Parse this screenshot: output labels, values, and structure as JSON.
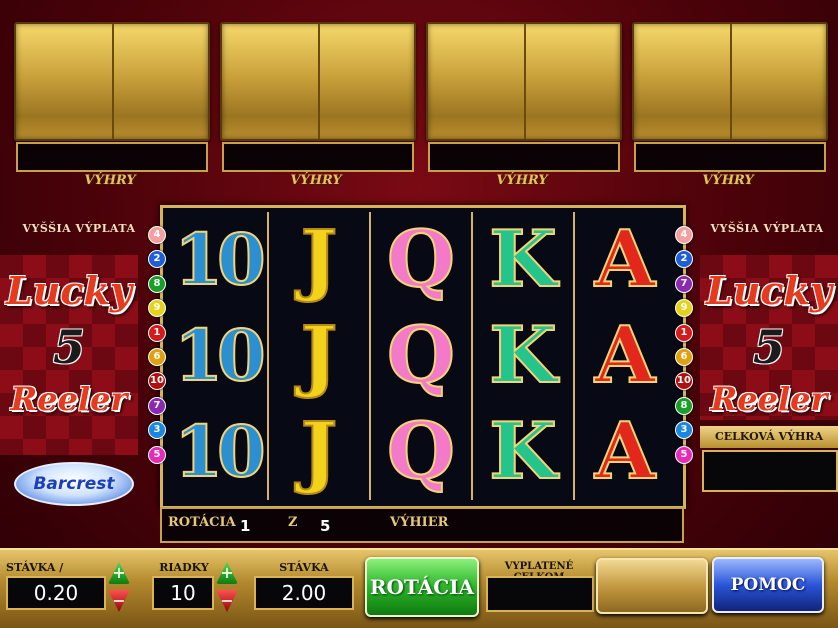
{
  "top_panels": {
    "win_label": "VÝHRY",
    "panels": [
      {
        "label": "VÝHRY"
      },
      {
        "label": "VÝHRY"
      },
      {
        "label": "VÝHRY"
      },
      {
        "label": "VÝHRY"
      }
    ]
  },
  "left_panel": {
    "vyssia": "VYŠŠIA VÝPLATA",
    "lucky": "Lucky",
    "five": "5",
    "reeler": "Reeler",
    "logo": "Barcrest"
  },
  "right_panel": {
    "vyssia": "VYŠŠIA VÝPLATA",
    "lucky": "Lucky",
    "five": "5",
    "reeler": "Reeler",
    "total_win_label": "CELKOVÁ VÝHRA"
  },
  "reels": [
    {
      "symbol": "10",
      "rows": [
        "10",
        "10",
        "10"
      ]
    },
    {
      "symbol": "J",
      "rows": [
        "J",
        "J",
        "J"
      ]
    },
    {
      "symbol": "Q",
      "rows": [
        "Q",
        "Q",
        "Q"
      ]
    },
    {
      "symbol": "K",
      "rows": [
        "K",
        "K",
        "K"
      ]
    },
    {
      "symbol": "A",
      "rows": [
        "A",
        "A",
        "A"
      ]
    }
  ],
  "left_markers": [
    {
      "n": "4",
      "color": "#f4a0a0"
    },
    {
      "n": "2",
      "color": "#1f5fd6"
    },
    {
      "n": "8",
      "color": "#1a9e2a"
    },
    {
      "n": "9",
      "color": "#e6d21a"
    },
    {
      "n": "1",
      "color": "#d41a1a"
    },
    {
      "n": "6",
      "color": "#e0a010"
    },
    {
      "n": "10",
      "color": "#b01010"
    },
    {
      "n": "7",
      "color": "#8a2ab0"
    },
    {
      "n": "3",
      "color": "#1a88e0"
    },
    {
      "n": "5",
      "color": "#e82ab8"
    }
  ],
  "right_markers": [
    {
      "n": "4",
      "color": "#f4a0a0"
    },
    {
      "n": "2",
      "color": "#1f5fd6"
    },
    {
      "n": "7",
      "color": "#8a2ab0"
    },
    {
      "n": "9",
      "color": "#e6d21a"
    },
    {
      "n": "1",
      "color": "#d41a1a"
    },
    {
      "n": "6",
      "color": "#e0a010"
    },
    {
      "n": "10",
      "color": "#b01010"
    },
    {
      "n": "8",
      "color": "#1a9e2a"
    },
    {
      "n": "3",
      "color": "#1a88e0"
    },
    {
      "n": "5",
      "color": "#e82ab8"
    }
  ],
  "info_row": {
    "spin_label": "ROTÁCIA",
    "spin_current": "1",
    "of_label": "Z",
    "spin_total": "5",
    "wins_label": "VÝHIER"
  },
  "controls": {
    "stake_per_line_label": "STÁVKA / RIADOK",
    "stake_per_line_value": "0.20",
    "lines_label": "RIADKY",
    "lines_value": "10",
    "stake_label": "STÁVKA",
    "stake_value": "2.00",
    "spin_button": "ROTÁCIA",
    "paid_total_label": "VYPLATENÉ CELKOM",
    "help_button": "POMOC",
    "plus": "+",
    "minus": "−"
  }
}
